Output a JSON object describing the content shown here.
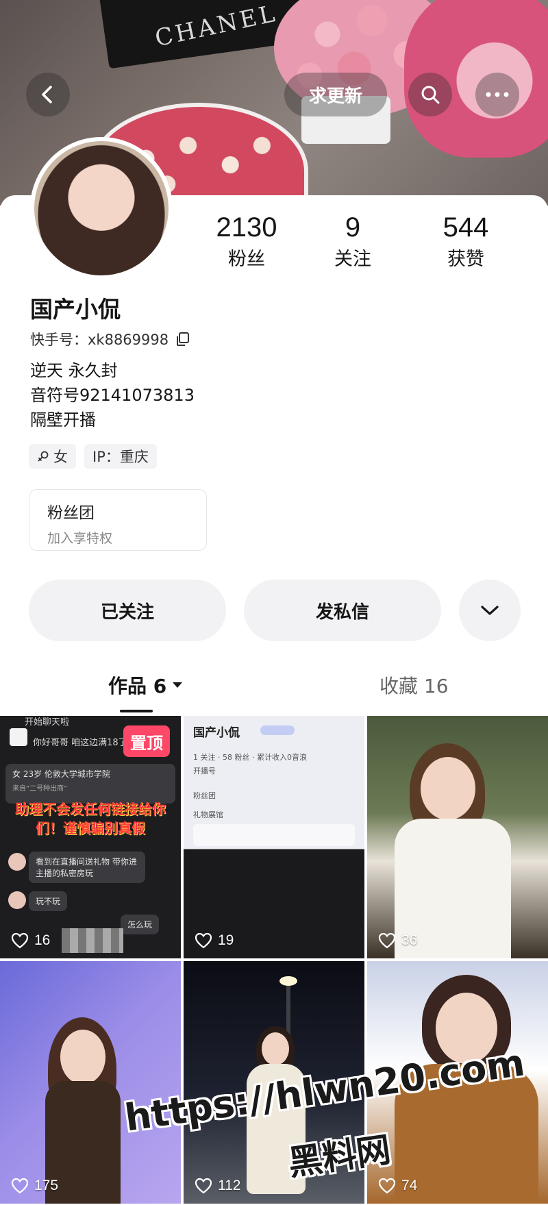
{
  "header": {
    "update_label": "求更新",
    "cover_text": "CHANEL"
  },
  "profile": {
    "name": "国产小侃",
    "ks_id": "快手号：xk8869998",
    "bio": [
      "逆天 永久封",
      "音符号92141073813",
      "隔壁开播"
    ],
    "tags": {
      "gender": "女",
      "ip": "IP：重庆"
    }
  },
  "stats": [
    {
      "value": "2130",
      "label": "粉丝"
    },
    {
      "value": "9",
      "label": "关注"
    },
    {
      "value": "544",
      "label": "获赞"
    }
  ],
  "fan_club": {
    "title": "粉丝团",
    "subtitle": "加入享特权"
  },
  "actions": {
    "follow": "已关注",
    "message": "发私信"
  },
  "tabs": {
    "works": "作品 6",
    "favorites": "收藏 16"
  },
  "works": [
    {
      "likes": "16",
      "pinned_label": "置顶",
      "texts": {
        "top": "开始聊天啦",
        "chat1": "你好哥哥 咱这边满18了嘛",
        "profile_line": "女   23岁   伦敦大学城市学院",
        "profile_sub": "来自“二号种出商”",
        "warning": "助理不会发任何链接给你们！谨慎骗别真假",
        "chat2": "看到在直播间送礼物 带你进主播的私密房玩",
        "chat3": "玩不玩",
        "chat4": "怎么玩"
      }
    },
    {
      "likes": "19",
      "texts": {
        "name": "国产小侃",
        "line1": "1 关注 · 58 粉丝 · 累计收入0音浪",
        "line2": "开播号",
        "line3": "粉丝团",
        "line4": "礼物展馆"
      }
    },
    {
      "likes": "36"
    },
    {
      "likes": "175"
    },
    {
      "likes": "112"
    },
    {
      "likes": "74"
    }
  ],
  "watermark": {
    "url": "https://hlwn20.com",
    "site": "黑料网"
  }
}
